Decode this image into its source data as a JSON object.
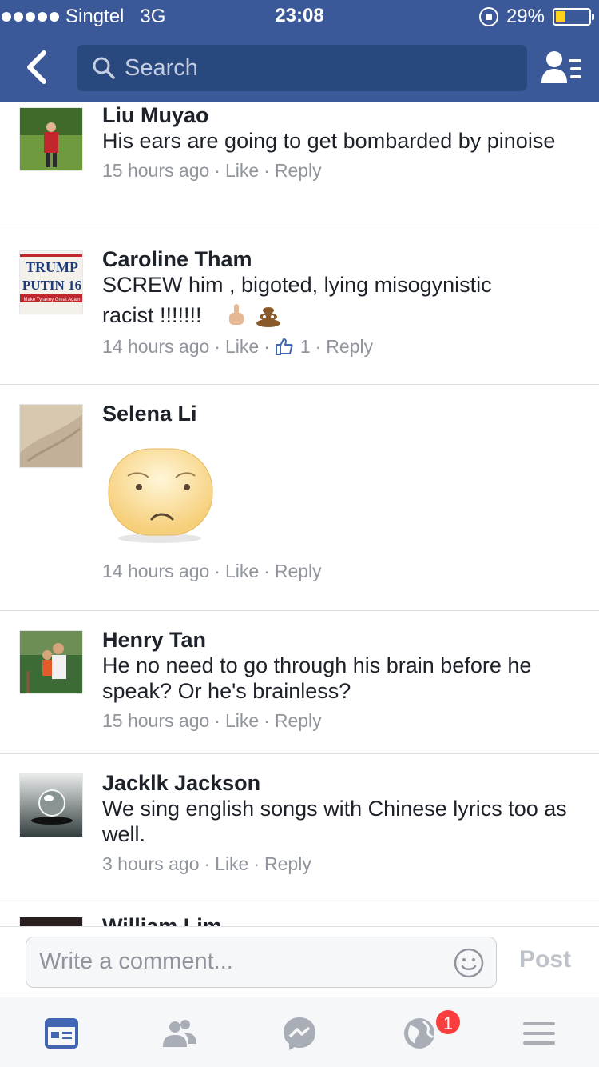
{
  "status": {
    "carrier": "Singtel",
    "network": "3G",
    "time": "23:08",
    "battery_percent": "29%",
    "battery_level": 0.29
  },
  "header": {
    "search_placeholder": "Search"
  },
  "comments": [
    {
      "name": "Liu Muyao",
      "text": "His ears are going to get bombarded by pinoise",
      "time": "15 hours ago",
      "like": "Like",
      "reply": "Reply"
    },
    {
      "name": "Caroline Tham",
      "text": "SCREW him , bigoted, lying misogynistic",
      "text2": "racist !!!!!!!",
      "avatar_text_1": "TRUMP",
      "avatar_text_2": "PUTIN 16",
      "avatar_text_3": "Make Tyranny Great Again",
      "time": "14 hours ago",
      "like": "Like",
      "like_count": "1",
      "reply": "Reply"
    },
    {
      "name": "Selena Li",
      "time": "14 hours ago",
      "like": "Like",
      "reply": "Reply"
    },
    {
      "name": "Henry Tan",
      "text": "He no need to go through his brain before he speak? Or he's brainless?",
      "time": "15 hours ago",
      "like": "Like",
      "reply": "Reply"
    },
    {
      "name": "Jacklk Jackson",
      "text": "We sing english songs with Chinese lyrics too as well.",
      "time": "3 hours ago",
      "like": "Like",
      "reply": "Reply"
    },
    {
      "name": "William Lim"
    }
  ],
  "composer": {
    "placeholder": "Write a comment...",
    "post_label": "Post"
  },
  "tabbar": {
    "notifications_badge": "1"
  },
  "colors": {
    "brand": "#3b5998",
    "search_bg": "#29487d",
    "meta_gray": "#90949c",
    "badge_red": "#fa3e3e"
  }
}
